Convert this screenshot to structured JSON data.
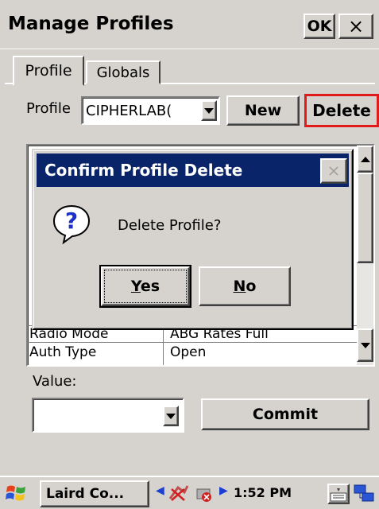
{
  "window": {
    "title": "Manage Profiles",
    "ok_label": "OK",
    "close_label": "×"
  },
  "tabs": [
    {
      "label": "Profile",
      "active": true
    },
    {
      "label": "Globals",
      "active": false
    }
  ],
  "profile": {
    "label": "Profile",
    "selected": "CIPHERLAB(",
    "new_label": "New",
    "delete_label": "Delete"
  },
  "list": {
    "rows": [
      {
        "name": "Radio Mode",
        "value": "ABG Rates Full"
      },
      {
        "name": "Auth Type",
        "value": "Open"
      }
    ]
  },
  "value": {
    "label": "Value:",
    "selected": "",
    "commit_label": "Commit"
  },
  "dialog": {
    "title": "Confirm Profile Delete",
    "message": "Delete Profile?",
    "yes_label": "Yes",
    "yes_mnemonic": "Y",
    "yes_rest": "es",
    "no_label": "No",
    "no_mnemonic": "N",
    "no_rest": "o",
    "icon": "question-icon"
  },
  "taskbar": {
    "task_label": "Laird Co...",
    "time": "1:52 PM",
    "icons": [
      "windows-start-icon",
      "network-icon",
      "battery-icon",
      "keyboard-icon",
      "connection-icon"
    ]
  },
  "colors": {
    "dialog_title_bg": "#0a246a",
    "highlight_border": "#e31a1a",
    "face": "#d6d3ce"
  }
}
